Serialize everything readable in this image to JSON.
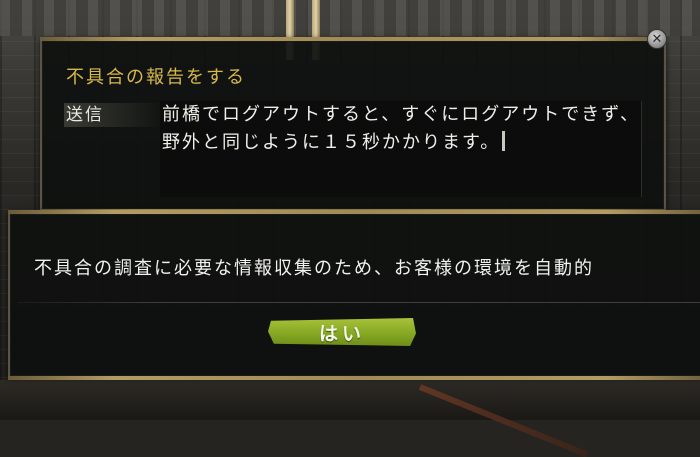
{
  "report_panel": {
    "title": "不具合の報告をする",
    "send_label": "送信",
    "report_text": "前橋でログアウトすると、すぐにログアウトできず、野外と同じように１５秒かかります。",
    "close_icon": "close-icon"
  },
  "confirm_dialog": {
    "message": "不具合の調査に必要な情報収集のため、お客様の環境を自動的",
    "yes_label": "はい"
  },
  "colors": {
    "title_gold": "#d7b94a",
    "button_green": "#86a823",
    "panel_bg": "#0e100f"
  }
}
